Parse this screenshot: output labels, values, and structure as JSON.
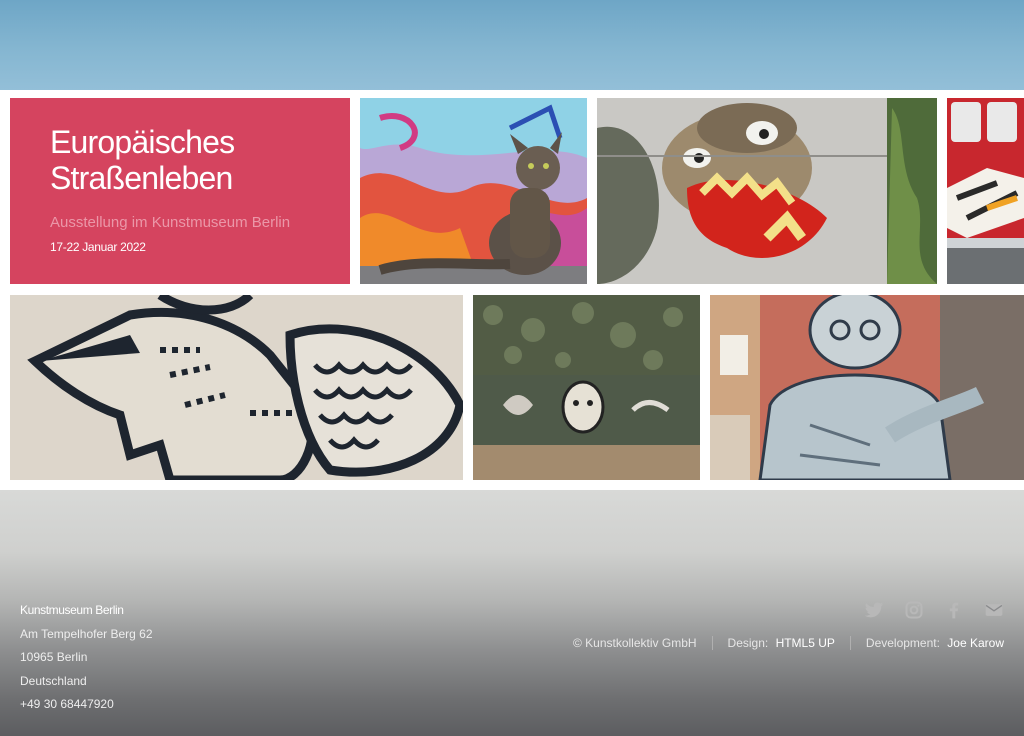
{
  "hero": {
    "title_line1": "Europäisches",
    "title_line2": "Straßenleben",
    "subtitle": "Ausstellung im Kunstmuseum Berlin",
    "date": "17-22 Januar 2022"
  },
  "gallery": {
    "images": [
      {
        "subject": "cat on graffiti wall"
      },
      {
        "subject": "graffiti face with red lips"
      },
      {
        "subject": "graffiti on red train"
      },
      {
        "subject": "black outline bird mural"
      },
      {
        "subject": "graffiti on ivy covered wall"
      },
      {
        "subject": "old man mural on building"
      }
    ]
  },
  "footer": {
    "address": {
      "name": "Kunstmuseum Berlin",
      "street": "Am Tempelhofer Berg 62",
      "city": "10965 Berlin",
      "country": "Deutschland",
      "phone": "+49 30 68447920"
    },
    "social_icons": [
      "twitter-icon",
      "instagram-icon",
      "facebook-icon",
      "envelope-icon"
    ],
    "copyright": "© Kunstkollektiv GmbH",
    "design_label": "Design:",
    "design_link": "HTML5 UP",
    "dev_label": "Development:",
    "dev_link": "Joe Karow"
  },
  "colors": {
    "accent": "#d5445f",
    "sky": "#85b6d1"
  }
}
